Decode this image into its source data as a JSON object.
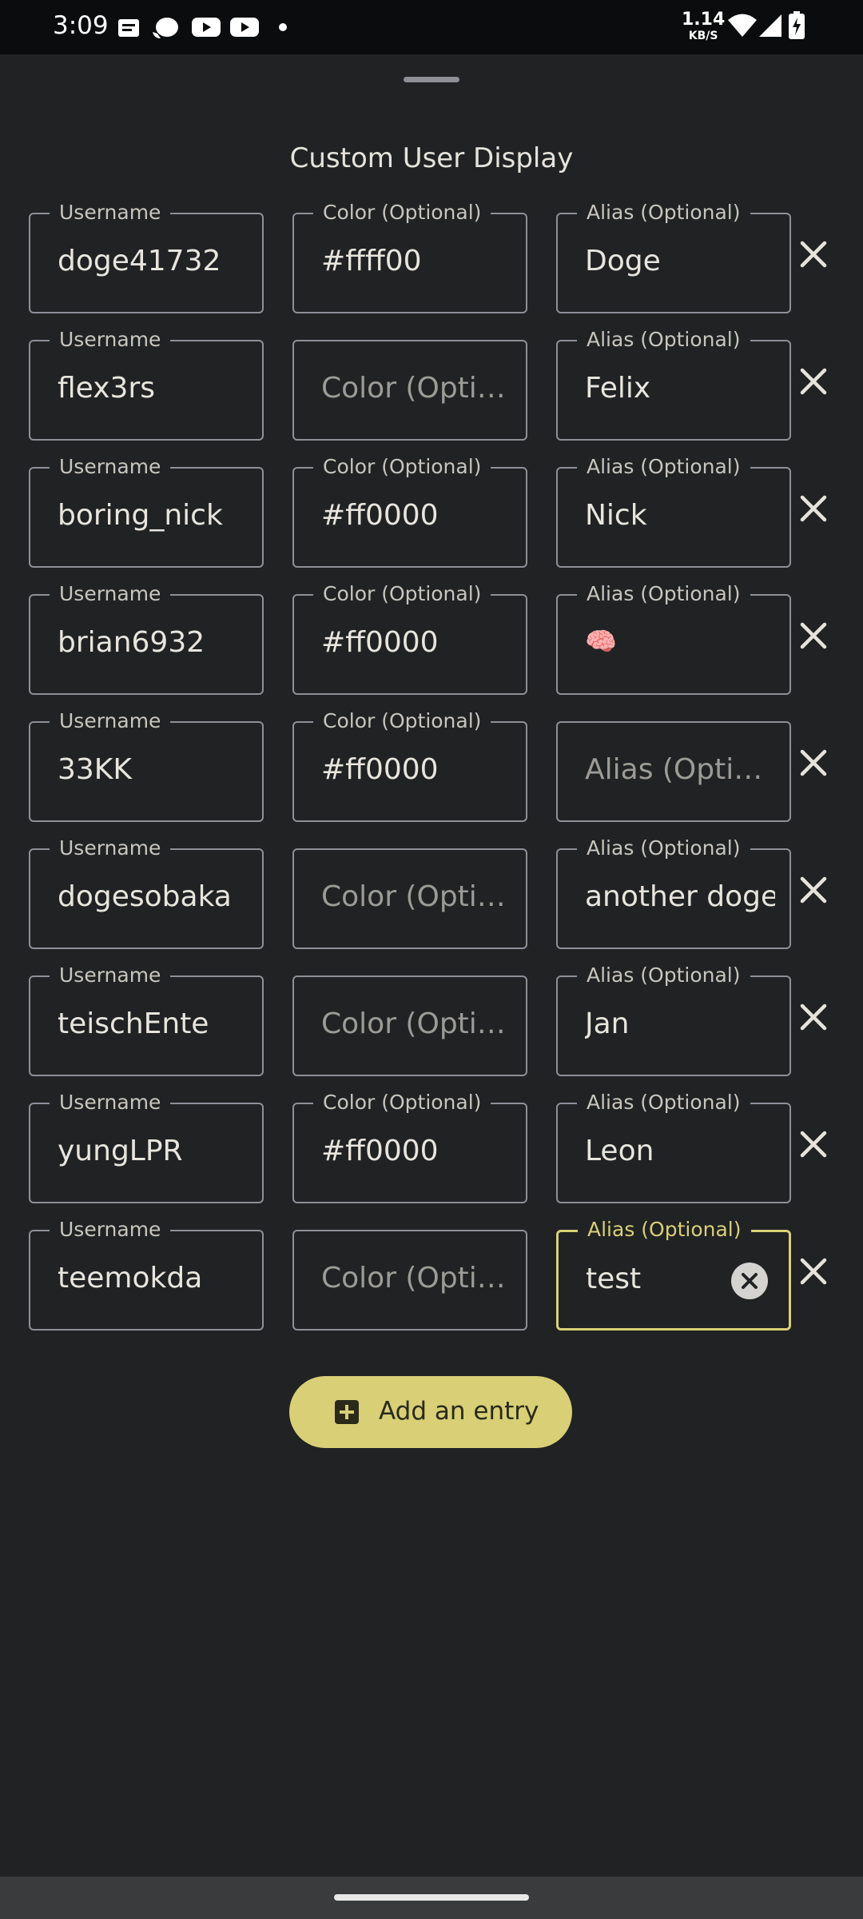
{
  "status_bar": {
    "time": "3:09",
    "speed_value": "1.14",
    "speed_unit": "KB/S"
  },
  "title": "Custom User Display",
  "labels": {
    "username": "Username",
    "color": "Color (Optional)",
    "alias": "Alias (Optional)"
  },
  "entries": [
    {
      "username": "doge41732",
      "color": "#ffff00",
      "alias": "Doge"
    },
    {
      "username": "flex3rs",
      "color": "",
      "alias": "Felix"
    },
    {
      "username": "boring_nick",
      "color": "#ff0000",
      "alias": "Nick"
    },
    {
      "username": "brian6932",
      "color": "#ff0000",
      "alias": "🧠"
    },
    {
      "username": "33KK",
      "color": "#ff0000",
      "alias": ""
    },
    {
      "username": "dogesobaka",
      "color": "",
      "alias": "another doge"
    },
    {
      "username": "teischEnte",
      "color": "",
      "alias": "Jan"
    },
    {
      "username": "yungLPR",
      "color": "#ff0000",
      "alias": "Leon"
    },
    {
      "username": "teemokda",
      "color": "",
      "alias": "test"
    }
  ],
  "placeholders": {
    "color": "Color (Optional)",
    "alias": "Alias (Optional)"
  },
  "add_button_label": "Add an entry",
  "colors": {
    "background": "#202224",
    "accent": "#d8cf76",
    "outline": "#8e9097"
  }
}
